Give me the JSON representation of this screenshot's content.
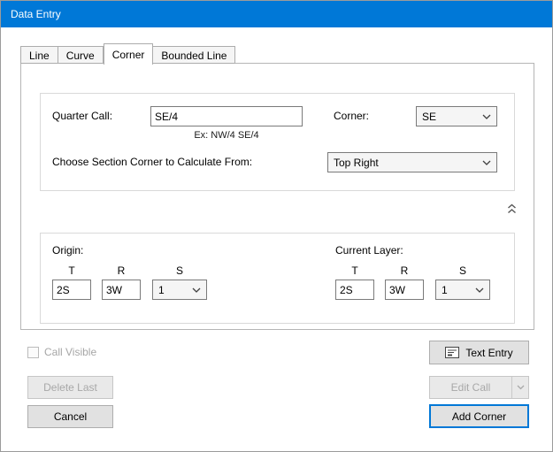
{
  "window": {
    "title": "Data Entry"
  },
  "colors": {
    "titlebar": "#0078D7",
    "accent": "#0078D7"
  },
  "icons": {
    "combo_arrow": "chevron-down",
    "collapse": "chevron-double-up",
    "text_entry": "text-form",
    "edit_call_arrow": "chevron-down"
  },
  "tabs": [
    {
      "label": "Line"
    },
    {
      "label": "Curve"
    },
    {
      "label": "Corner"
    },
    {
      "label": "Bounded Line"
    }
  ],
  "corner_tab": {
    "quarter_call_label": "Quarter Call:",
    "quarter_call_value": "SE/4",
    "quarter_call_hint": "Ex: NW/4 SE/4",
    "corner_label": "Corner:",
    "corner_value": "SE",
    "section_corner_label": "Choose Section Corner to Calculate From:",
    "section_corner_value": "Top Right",
    "origin": {
      "label": "Origin:",
      "col_t": "T",
      "col_r": "R",
      "col_s": "S",
      "t_value": "2S",
      "r_value": "3W",
      "s_value": "1"
    },
    "current_layer": {
      "label": "Current Layer:",
      "col_t": "T",
      "col_r": "R",
      "col_s": "S",
      "t_value": "2S",
      "r_value": "3W",
      "s_value": "1"
    }
  },
  "footer": {
    "call_visible": "Call Visible",
    "text_entry": "Text Entry",
    "delete_last": "Delete Last",
    "edit_call": "Edit Call",
    "cancel": "Cancel",
    "add_corner": "Add Corner"
  }
}
